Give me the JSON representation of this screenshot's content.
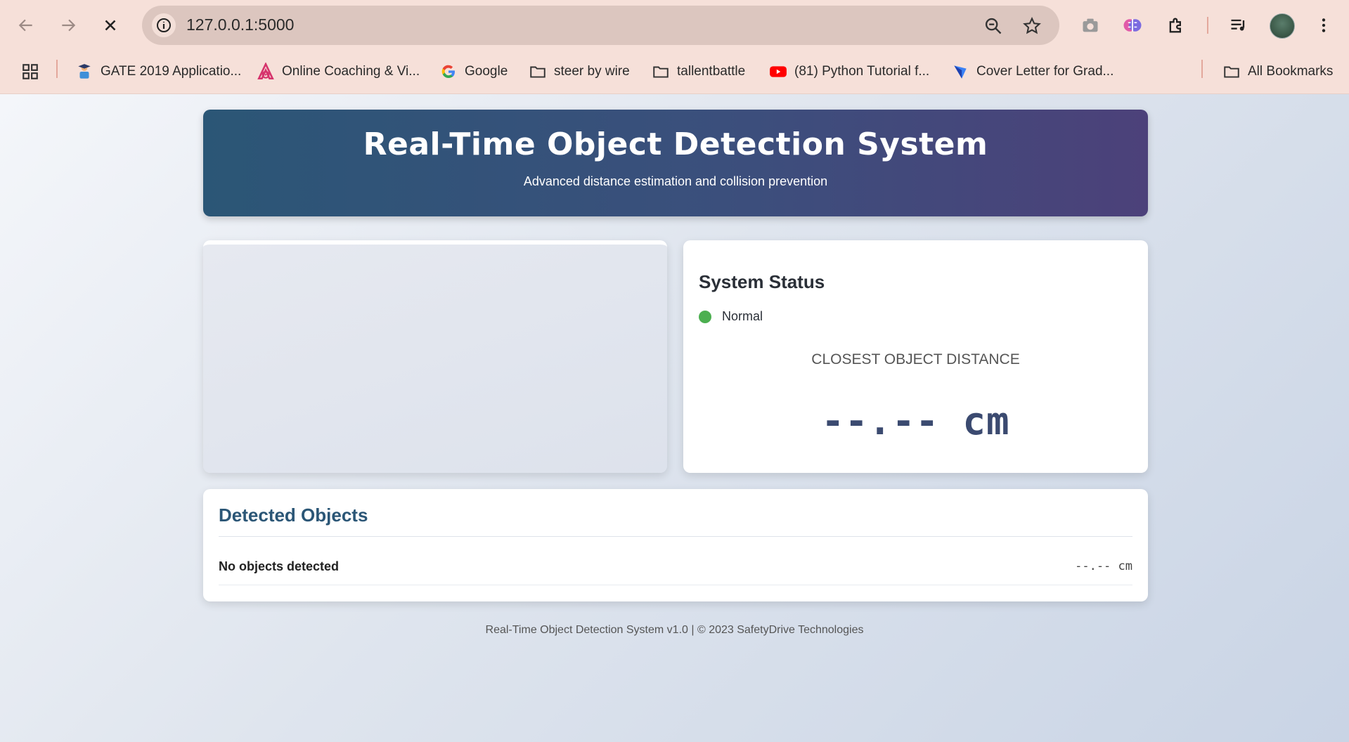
{
  "browser": {
    "url": "127.0.0.1:5000",
    "icons": [
      "back-icon",
      "forward-icon",
      "stop-icon",
      "site-info-icon",
      "zoom-icon",
      "star-icon",
      "camera-icon",
      "brain-extension-icon",
      "extensions-icon",
      "media-icon",
      "profile-avatar",
      "menu-icon"
    ],
    "bookmarks": [
      {
        "label": "GATE 2019 Applicatio...",
        "icon": "gate-icon"
      },
      {
        "label": "Online Coaching & Vi...",
        "icon": "coaching-icon"
      },
      {
        "label": "Google",
        "icon": "google-icon"
      },
      {
        "label": "steer by wire",
        "icon": "folder-icon"
      },
      {
        "label": "tallentbattle",
        "icon": "folder-icon"
      },
      {
        "label": "(81) Python Tutorial f...",
        "icon": "youtube-icon"
      },
      {
        "label": "Cover Letter for Grad...",
        "icon": "cover-letter-icon"
      }
    ],
    "all_bookmarks": "All Bookmarks"
  },
  "header": {
    "title": "Real-Time Object Detection System",
    "subtitle": "Advanced distance estimation and collision prevention"
  },
  "status": {
    "title": "System Status",
    "state": "Normal",
    "state_color": "#4caf50",
    "closest_label": "CLOSEST OBJECT DISTANCE",
    "closest_value": "--.-- cm"
  },
  "objects": {
    "title": "Detected Objects",
    "rows": [
      {
        "name": "No objects detected",
        "distance": "--.-- cm"
      }
    ]
  },
  "footer": "Real-Time Object Detection System v1.0 | © 2023 SafetyDrive Technologies",
  "colors": {
    "header_start": "#2b5676",
    "header_end": "#4c417a",
    "accent_text": "#2b5676",
    "distance_text": "#3b4a70"
  }
}
